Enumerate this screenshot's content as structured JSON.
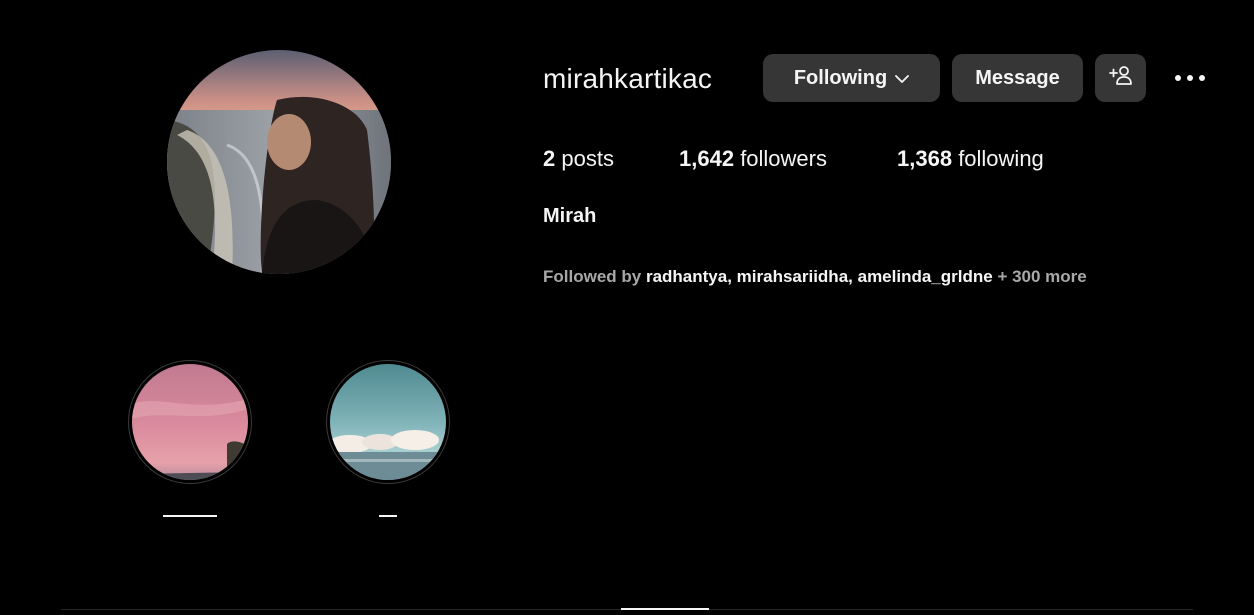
{
  "profile": {
    "username": "mirahkartikac",
    "full_name": "Mirah",
    "avatar_icon": "profile-photo"
  },
  "actions": {
    "following_label": "Following",
    "message_label": "Message",
    "suggest_icon": "add-person-icon",
    "more_icon": "more-horizontal-icon"
  },
  "stats": {
    "posts_count": "2",
    "posts_label": "posts",
    "followers_count": "1,642",
    "followers_label": "followers",
    "following_count": "1,368",
    "following_label": "following"
  },
  "followed_by": {
    "prefix": "Followed by ",
    "users": [
      "radhantya",
      "mirahsariidha",
      "amelinda_grldne"
    ],
    "more": " + 300 more"
  },
  "highlights": [
    {
      "label": "",
      "theme": "pink-sunset"
    },
    {
      "label": "",
      "theme": "blue-sky-clouds"
    }
  ],
  "colors": {
    "background": "#000000",
    "button_bg": "#363636",
    "text_primary": "#f5f5f5",
    "text_secondary": "#a8a8a8"
  }
}
